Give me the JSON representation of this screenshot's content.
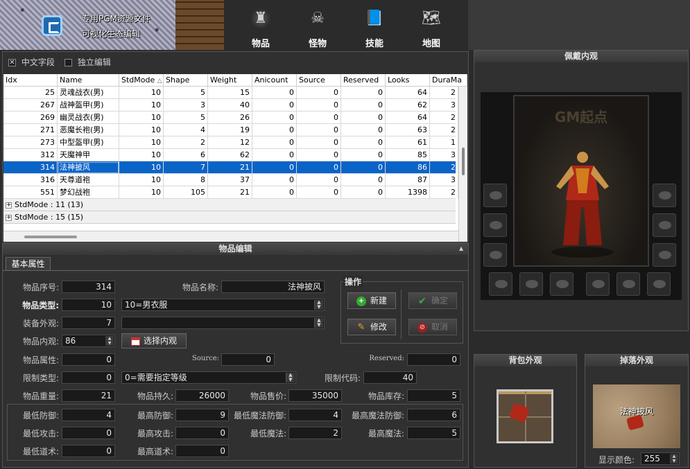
{
  "banner": {
    "line1": "专用PGM资源文件",
    "line2": "可视化生态编辑"
  },
  "nav": [
    {
      "label": "物品",
      "icon": "bag-icon",
      "glyph": "♜",
      "selected": true
    },
    {
      "label": "怪物",
      "icon": "skull-icon",
      "glyph": "☠",
      "selected": false
    },
    {
      "label": "技能",
      "icon": "skill-book-icon",
      "glyph": "📘",
      "selected": false
    },
    {
      "label": "地图",
      "icon": "map-icon",
      "glyph": "🗺",
      "selected": false
    }
  ],
  "options": {
    "chinese_fields": {
      "label": "中文字段",
      "checked": true
    },
    "independent_edit": {
      "label": "独立编辑",
      "checked": false
    }
  },
  "table": {
    "columns": [
      "Idx",
      "Name",
      "StdMode",
      "Shape",
      "Weight",
      "Anicount",
      "Source",
      "Reserved",
      "Looks",
      "DuraMa"
    ],
    "sort_indicator": "△",
    "rows": [
      [
        "25",
        "灵魂战衣(男)",
        "10",
        "5",
        "15",
        "0",
        "0",
        "0",
        "64",
        "2"
      ],
      [
        "267",
        "战神盔甲(男)",
        "10",
        "3",
        "40",
        "0",
        "0",
        "0",
        "62",
        "3"
      ],
      [
        "269",
        "幽灵战衣(男)",
        "10",
        "5",
        "26",
        "0",
        "0",
        "0",
        "64",
        "2"
      ],
      [
        "271",
        "恶魔长袍(男)",
        "10",
        "4",
        "19",
        "0",
        "0",
        "0",
        "63",
        "2"
      ],
      [
        "273",
        "中型盔甲(男)",
        "10",
        "2",
        "12",
        "0",
        "0",
        "0",
        "61",
        "1"
      ],
      [
        "312",
        "天魔神甲",
        "10",
        "6",
        "62",
        "0",
        "0",
        "0",
        "85",
        "3"
      ],
      [
        "314",
        "法神披风",
        "10",
        "7",
        "21",
        "0",
        "0",
        "0",
        "86",
        "2"
      ],
      [
        "316",
        "天尊道袍",
        "10",
        "8",
        "37",
        "0",
        "0",
        "0",
        "87",
        "3"
      ],
      [
        "551",
        "梦幻战袍",
        "10",
        "105",
        "21",
        "0",
        "0",
        "0",
        "1398",
        "2"
      ]
    ],
    "selected_index": 6,
    "groups": [
      "StdMode : 11 (13)",
      "StdMode : 15 (15)"
    ]
  },
  "editor": {
    "title": "物品编辑",
    "tab": "基本属性",
    "fields": {
      "idx_label": "物品序号:",
      "idx_value": "314",
      "name_label": "物品名称:",
      "name_value": "法神披风",
      "type_label": "物品类型:",
      "type_value": "10",
      "type_option": "10=男衣服",
      "shape_label": "装备外观:",
      "shape_value": "7",
      "shape_option": "",
      "looks_label": "物品内观:",
      "looks_value": "86",
      "choose_looks": "选择内观",
      "attr_label": "物品属性:",
      "attr_value": "0",
      "source_label": "Source:",
      "source_value": "0",
      "reserved_label": "Reserved:",
      "reserved_value": "0",
      "limit_type_label": "限制类型:",
      "limit_type_value": "0",
      "limit_type_option": "0=需要指定等级",
      "limit_code_label": "限制代码:",
      "limit_code_value": "40",
      "weight_label": "物品重量:",
      "weight_value": "21",
      "dura_label": "物品持久:",
      "dura_value": "26000",
      "price_label": "物品售价:",
      "price_value": "35000",
      "stock_label": "物品库存:",
      "stock_value": "5",
      "min_ac_label": "最低防御:",
      "min_ac_value": "4",
      "max_ac_label": "最高防御:",
      "max_ac_value": "9",
      "min_mac_label": "最低魔法防御:",
      "min_mac_value": "4",
      "max_mac_label": "最高魔法防御:",
      "max_mac_value": "6",
      "min_dc_label": "最低攻击:",
      "min_dc_value": "0",
      "max_dc_label": "最高攻击:",
      "max_dc_value": "0",
      "min_mc_label": "最低魔法:",
      "min_mc_value": "2",
      "max_mc_label": "最高魔法:",
      "max_mc_value": "5",
      "min_sc_label": "最低道术:",
      "min_sc_value": "0",
      "max_sc_label": "最高道术:",
      "max_sc_value": "0"
    },
    "ops": {
      "title": "操作",
      "new": "新建",
      "confirm": "确定",
      "modify": "修改",
      "cancel": "取消"
    }
  },
  "right": {
    "equip_title": "佩戴内观",
    "watermark": "GM起点",
    "bag_title": "背包外观",
    "drop_title": "掉落外观",
    "drop_item_name": "法神披风",
    "display_color_label": "显示颜色:",
    "display_color_value": "255"
  },
  "colors": {
    "selection": "#0a64c8",
    "accent": "#1e6ab0"
  }
}
